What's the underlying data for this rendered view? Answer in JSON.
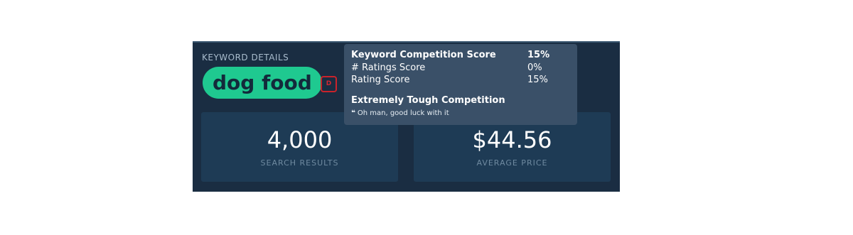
{
  "keyword_details": {
    "section_label": "KEYWORD DETAILS",
    "keyword": "dog food",
    "grade_badge": "D"
  },
  "stats": [
    {
      "value": "4,000",
      "label": "SEARCH RESULTS"
    },
    {
      "value": "$44.56",
      "label": "AVERAGE PRICE"
    }
  ],
  "tooltip": {
    "rows": [
      {
        "label": "Keyword Competition Score",
        "value": "15%"
      },
      {
        "label": "# Ratings Score",
        "value": "0%"
      },
      {
        "label": "Rating Score",
        "value": "15%"
      }
    ],
    "verdict": "Extremely Tough Competition",
    "note_icon": "quote-icon",
    "note_glyph": "❝",
    "note": "Oh man, good luck with it"
  },
  "colors": {
    "panel_bg": "#1a2d42",
    "card_bg": "#1e3b55",
    "keyword_pill": "#1fc990",
    "grade_badge": "#c9232b",
    "tooltip_bg": "#3a5068"
  }
}
